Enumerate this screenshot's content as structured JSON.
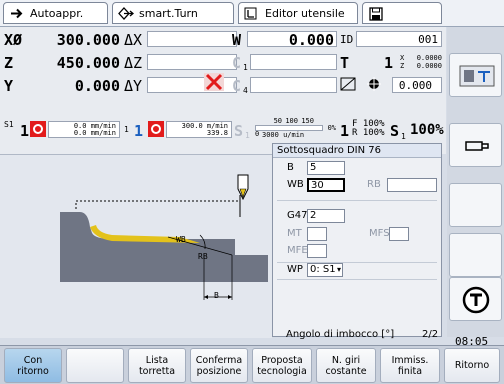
{
  "tabs": [
    {
      "label": "Autoappr.",
      "icon": "arrow-right-icon"
    },
    {
      "label": "smart.Turn",
      "icon": "diamond-arrow-icon"
    },
    {
      "label": "Editor utensile",
      "icon": "tool-editor-icon"
    },
    {
      "label": "",
      "icon": "disk-icon"
    }
  ],
  "axes": [
    {
      "name": "XØ",
      "value": "300.000",
      "delta": "ΔX"
    },
    {
      "name": "Z",
      "value": "450.000",
      "delta": "ΔZ"
    },
    {
      "name": "Y",
      "value": "0.000",
      "delta": "ΔY"
    }
  ],
  "aux": {
    "w_label": "W",
    "w_value": "0.000",
    "id_label": "ID",
    "id_value": "001",
    "c1_label": "C",
    "c1_sub": "1",
    "c4_label": "C",
    "c4_sub": "4",
    "t_label": "T",
    "t_value": "1",
    "xz_x_label": "X",
    "xz_x_value": "0.0000",
    "xz_z_label": "Z",
    "xz_z_value": "0.0000",
    "spindle_value": "0.000"
  },
  "feed": {
    "s1_label": "S1",
    "s1_num": "1",
    "feed_top": "0.0 mm/min",
    "feed_bot": "0.0 mm/min",
    "t1_num": "1",
    "t1_box": "1",
    "speed_top": "300.0 m/min",
    "speed_bot": "339.8",
    "s_label": "S",
    "s_sub": "1",
    "scale": [
      "50",
      "100",
      "150"
    ],
    "scale_min": "0",
    "scale_val": "3000 u/min",
    "pct": "0%",
    "f_num": "1",
    "f_pct": "F 100%",
    "r_pct": "R 100%",
    "s_main": "S",
    "s_main_sub": "1",
    "s_main_pct": "100%"
  },
  "form": {
    "title": "Sottosquadro DIN 76",
    "fields": {
      "b_label": "B",
      "b_value": "5",
      "wb_label": "WB",
      "wb_value": "30",
      "rb_label": "RB",
      "rb_value": "",
      "g47_label": "G47",
      "g47_value": "2",
      "mt_label": "MT",
      "mt_value": "",
      "mfs_label": "MFS",
      "mfs_value": "",
      "mfe_label": "MFE",
      "mfe_value": "",
      "wp_label": "WP",
      "wp_value": "0: S1"
    },
    "hint": "Angolo di imbocco [°]",
    "page": "2/2"
  },
  "graphic": {
    "label_wb": "WB",
    "label_rb": "RB",
    "label_b": "B"
  },
  "time": "08:05",
  "softkeys": [
    {
      "label": "Con\nritorno",
      "active": true
    },
    {
      "label": "",
      "active": false
    },
    {
      "label": "Lista\ntorretta",
      "active": false
    },
    {
      "label": "Conferma\nposizione",
      "active": false
    },
    {
      "label": "Proposta\ntecnologia",
      "active": false
    },
    {
      "label": "N. giri\ncostante",
      "active": false
    },
    {
      "label": "Immiss.\nfinita",
      "active": false
    },
    {
      "label": "Ritorno",
      "active": false
    }
  ],
  "colors": {
    "accent_blue": "#8fbce3",
    "tool_yellow": "#e3c21b",
    "workpiece_gray": "#6f7584",
    "alert_red": "#e21b1b"
  }
}
